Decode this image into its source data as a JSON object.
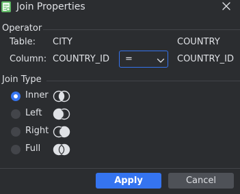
{
  "window": {
    "title": "Join Properties"
  },
  "operator": {
    "section_label": "Operator",
    "table_label": "Table:",
    "left_table": "CITY",
    "right_table": "COUNTRY",
    "column_label": "Column:",
    "left_column": "COUNTRY_ID",
    "operator_value": "=",
    "right_column": "COUNTRY_ID"
  },
  "join_type": {
    "section_label": "Join Type",
    "options": [
      {
        "label": "Inner",
        "selected": true,
        "icon": "inner-join-icon"
      },
      {
        "label": "Left",
        "selected": false,
        "icon": "left-join-icon"
      },
      {
        "label": "Right",
        "selected": false,
        "icon": "right-join-icon"
      },
      {
        "label": "Full",
        "selected": false,
        "icon": "full-join-icon"
      }
    ]
  },
  "buttons": {
    "apply": "Apply",
    "cancel": "Cancel"
  },
  "colors": {
    "background": "#2b2d30",
    "accent": "#3574f0",
    "text": "#dfe1e5",
    "secondary_button": "#4e5157"
  }
}
